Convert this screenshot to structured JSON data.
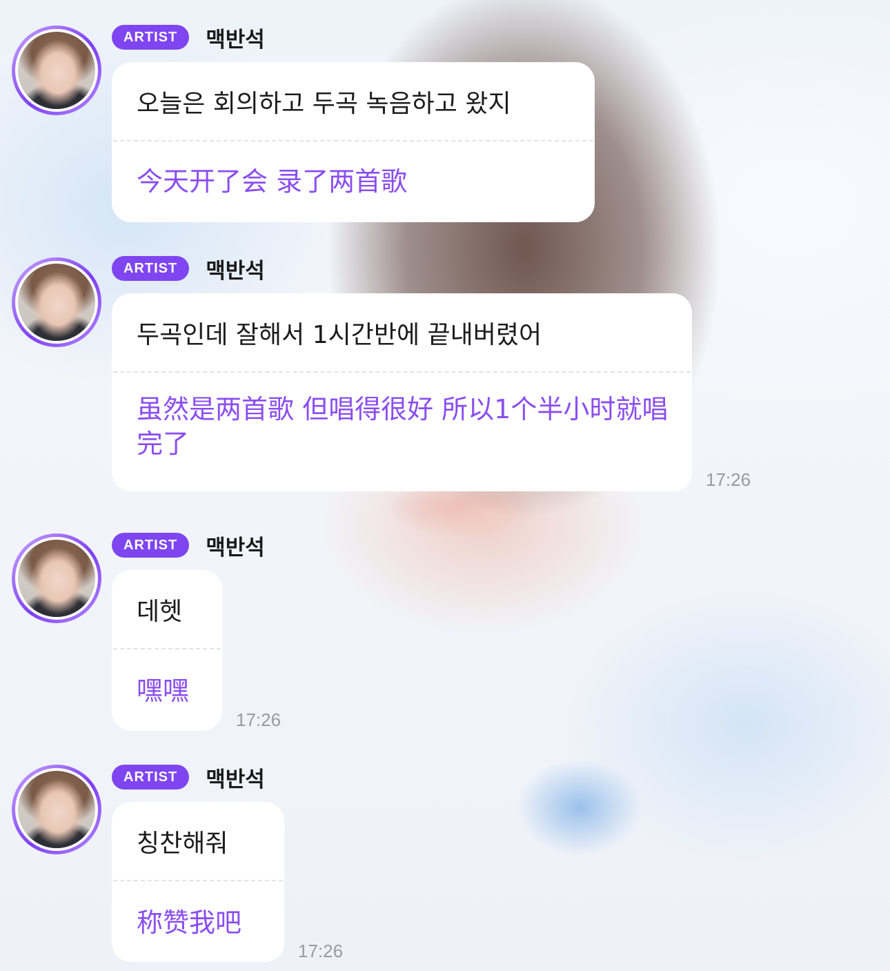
{
  "messages": [
    {
      "badge": "ARTIST",
      "sender": "맥반석",
      "original": "오늘은 회의하고 두곡 녹음하고 왔지",
      "translation": "今天开了会 录了两首歌",
      "time": ""
    },
    {
      "badge": "ARTIST",
      "sender": "맥반석",
      "original": "두곡인데 잘해서 1시간반에 끝내버렸어",
      "translation": "虽然是两首歌 但唱得很好 所以1个半小时就唱完了",
      "time": "17:26"
    },
    {
      "badge": "ARTIST",
      "sender": "맥반석",
      "original": "데헷",
      "translation": "嘿嘿",
      "time": "17:26"
    },
    {
      "badge": "ARTIST",
      "sender": "맥반석",
      "original": "칭찬해줘",
      "translation": "称赞我吧",
      "time": "17:26"
    }
  ]
}
